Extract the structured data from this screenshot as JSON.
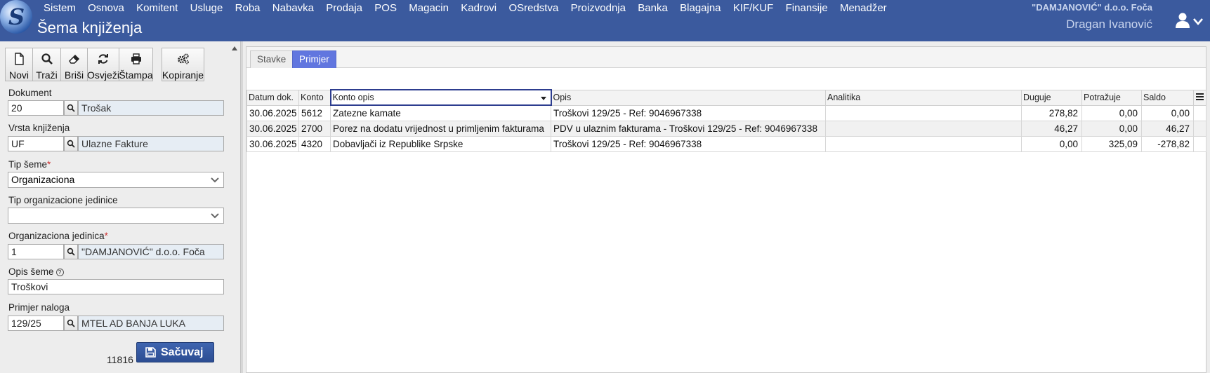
{
  "header": {
    "menu": [
      "Sistem",
      "Osnova",
      "Komitent",
      "Usluge",
      "Roba",
      "Nabavka",
      "Prodaja",
      "POS",
      "Magacin",
      "Kadrovi",
      "OSredstva",
      "Proizvodnja",
      "Banka",
      "Blagajna",
      "KIF/KUF",
      "Finansije",
      "Menadžer"
    ],
    "page_title": "Šema knjiženja",
    "company": "\"DAMJANOVIĆ\" d.o.o. Foča",
    "user": "Dragan Ivanović",
    "colors": {
      "bar": "#3b5a9e",
      "accent_tab": "#6176df",
      "save": "#2c4d92"
    }
  },
  "toolbar": {
    "new_label": "Novi",
    "search_label": "Traži",
    "delete_label": "Briši",
    "refresh_label": "Osvježi",
    "print_label": "Štampa",
    "copy_label": "Kopiranje"
  },
  "form": {
    "dokument": {
      "label": "Dokument",
      "code": "20",
      "name": "Trošak"
    },
    "vrsta": {
      "label": "Vrsta knjiženja",
      "code": "UF",
      "name": "Ulazne Fakture"
    },
    "tip_seme": {
      "label": "Tip šeme",
      "required": "*",
      "value": "Organizaciona"
    },
    "tip_org": {
      "label": "Tip organizacione jedinice",
      "value": ""
    },
    "org_jed": {
      "label": "Organizaciona jedinica",
      "required": "*",
      "code": "1",
      "name": "\"DAMJANOVIĆ\" d.o.o. Foča"
    },
    "opis": {
      "label": "Opis šeme",
      "help": "?",
      "value": "Troškovi"
    },
    "primjer": {
      "label": "Primjer naloga",
      "code": "129/25",
      "name": "MTEL AD BANJA LUKA"
    },
    "count": "11816",
    "save_label": "Sačuvaj"
  },
  "tabs": {
    "stavke": "Stavke",
    "primjer": "Primjer"
  },
  "grid": {
    "columns": [
      "Datum dok.",
      "Konto",
      "Konto opis",
      "Opis",
      "Analitika",
      "Duguje",
      "Potražuje",
      "Saldo"
    ],
    "rows": [
      [
        "30.06.2025",
        "5612",
        "Zatezne kamate",
        "Troškovi 129/25 - Ref: 9046967338",
        "",
        "278,82",
        "0,00",
        "0,00"
      ],
      [
        "30.06.2025",
        "2700",
        "Porez na dodatu vrijednost u primljenim fakturama",
        "PDV u ulaznim fakturama - Troškovi 129/25 - Ref: 9046967338",
        "",
        "46,27",
        "0,00",
        "46,27"
      ],
      [
        "30.06.2025",
        "4320",
        "Dobavljači iz Republike Srpske",
        "Troškovi 129/25 - Ref: 9046967338",
        "",
        "0,00",
        "325,09",
        "-278,82"
      ]
    ]
  }
}
